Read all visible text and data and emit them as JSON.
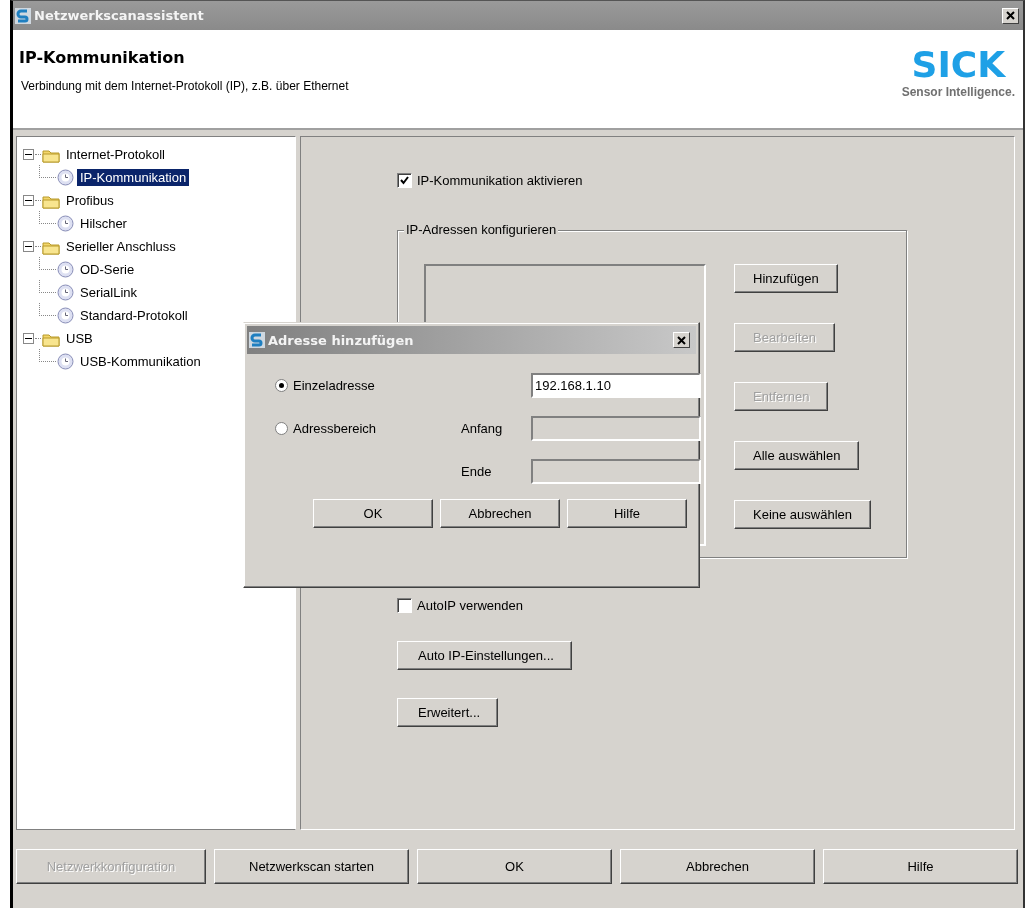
{
  "window": {
    "title": "Netzwerkscanassistent"
  },
  "header": {
    "title": "IP-Kommunikation",
    "subtitle": "Verbindung mit dem Internet-Protokoll (IP), z.B. über Ethernet",
    "logo": "SICK",
    "tagline": "Sensor Intelligence."
  },
  "tree": [
    {
      "label": "Internet-Protokoll",
      "expanded": true,
      "selected": false,
      "children": [
        {
          "label": "IP-Kommunikation",
          "selected": true
        }
      ]
    },
    {
      "label": "Profibus",
      "expanded": true,
      "selected": false,
      "children": [
        {
          "label": "Hilscher",
          "selected": false
        }
      ]
    },
    {
      "label": "Serieller Anschluss",
      "expanded": true,
      "selected": false,
      "children": [
        {
          "label": "OD-Serie",
          "selected": false
        },
        {
          "label": "SerialLink",
          "selected": false
        },
        {
          "label": "Standard-Protokoll",
          "selected": false
        }
      ]
    },
    {
      "label": "USB",
      "expanded": true,
      "selected": false,
      "children": [
        {
          "label": "USB-Kommunikation",
          "selected": false
        }
      ]
    }
  ],
  "settings": {
    "enable": {
      "label": "IP-Kommunikation aktivieren",
      "checked": true
    },
    "group": {
      "title": "IP-Adressen konfigurieren",
      "buttons": [
        {
          "label": "Hinzufügen",
          "disabled": false
        },
        {
          "label": "Bearbeiten",
          "disabled": true
        },
        {
          "label": "Entfernen",
          "disabled": true
        },
        {
          "label": "Alle auswählen",
          "disabled": false
        },
        {
          "label": "Keine auswählen",
          "disabled": false
        }
      ]
    },
    "autoip": {
      "label": "AutoIP verwenden",
      "checked": false
    },
    "buttons": [
      {
        "label": "Auto IP-Einstellungen...",
        "disabled": false
      },
      {
        "label": "Erweitert...",
        "disabled": false
      }
    ]
  },
  "dialog": {
    "title": "Adresse hinzufügen",
    "single": {
      "label": "Einzeladresse",
      "selected": true,
      "value": "192.168.1.10",
      "disabled": false
    },
    "range": {
      "label": "Adressbereich",
      "selected": false,
      "start_label": "Anfang",
      "start_disabled": true,
      "end_label": "Ende",
      "end_disabled": true
    },
    "buttons": [
      {
        "label": "OK",
        "disabled": false
      },
      {
        "label": "Abbrechen",
        "disabled": false
      },
      {
        "label": "Hilfe",
        "disabled": false
      }
    ]
  },
  "footer": [
    {
      "label": "Netzwerkkonfiguration",
      "disabled": true
    },
    {
      "label": "Netzwerkscan starten",
      "disabled": false
    },
    {
      "label": "OK",
      "disabled": false
    },
    {
      "label": "Abbrechen",
      "disabled": false
    },
    {
      "label": "Hilfe",
      "disabled": false
    }
  ]
}
